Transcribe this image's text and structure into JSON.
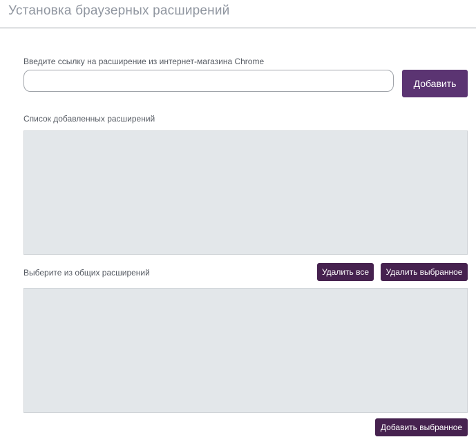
{
  "header": {
    "title": "Установка браузерных расширений"
  },
  "add_section": {
    "label": "Введите ссылку на расширение из интернет-магазина Chrome",
    "input_value": "",
    "input_placeholder": "",
    "add_button": "Добавить"
  },
  "added_list": {
    "label": "Список добавленных расширений",
    "items": [],
    "delete_all_button": "Удалить все",
    "delete_selected_button": "Удалить выбранное"
  },
  "common_list": {
    "label": "Выберите из общих расширений",
    "items": [],
    "add_selected_button": "Добавить выбранное"
  },
  "colors": {
    "primary": "#5b3472",
    "button_dark": "#46224f",
    "list_bg": "#e3e7ea",
    "title_text": "#9096a0"
  }
}
